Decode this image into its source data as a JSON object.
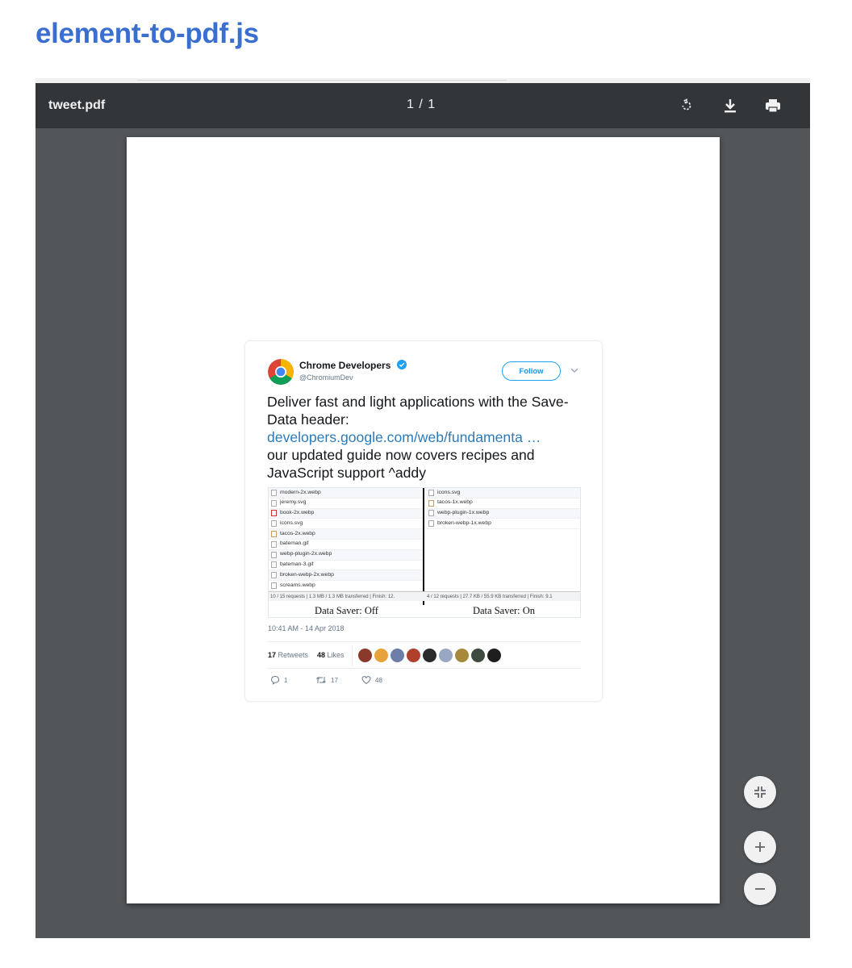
{
  "page": {
    "heading": "element-to-pdf.js"
  },
  "viewer": {
    "filename": "tweet.pdf",
    "page_indicator": "1 / 1",
    "icons": {
      "rotate": "rotate-icon",
      "download": "download-icon",
      "print": "print-icon",
      "fit": "fit-to-page-icon",
      "zoom_in": "zoom-in-icon",
      "zoom_out": "zoom-out-icon"
    }
  },
  "tweet": {
    "author_name": "Chrome Developers",
    "author_handle": "@ChromiumDev",
    "follow_label": "Follow",
    "text_line1": "Deliver fast and light applications with the Save-Data header:",
    "link": "developers.google.com/web/fundamenta …",
    "text_line2": "our updated guide now covers recipes and JavaScript support ^addy",
    "media": {
      "left_files": [
        "modern-2x.webp",
        "jeremy.svg",
        "book-2x.webp",
        "icons.svg",
        "tacos-2x.webp",
        "bateman.gif",
        "webp-plugin-2x.webp",
        "bateman-3.gif",
        "broken-webp-2x.webp",
        "screams.webp"
      ],
      "right_files": [
        "icons.svg",
        "tacos-1x.webp",
        "webp-plugin-1x.webp",
        "broken-webp-1x.webp"
      ],
      "left_summary": "10 / 15 requests | 1.3 MB / 1.3 MB transferred | Finish: 12.",
      "right_summary": "4 / 12 requests | 27.7 KB / 55.9 KB transferred | Finish: 9.1",
      "left_caption": "Data Saver: Off",
      "right_caption": "Data Saver: On"
    },
    "timestamp": "10:41 AM - 14 Apr 2018",
    "retweets_count": "17",
    "retweets_label": "Retweets",
    "likes_count": "48",
    "likes_label": "Likes",
    "reply_count": "1",
    "retweet_action_count": "17",
    "like_action_count": "48",
    "colors": {
      "accent": "#1da1f2",
      "link": "#2b7bb9",
      "heading": "#3a6fd0",
      "toolbar": "#323639",
      "viewer_bg": "#525659"
    }
  }
}
